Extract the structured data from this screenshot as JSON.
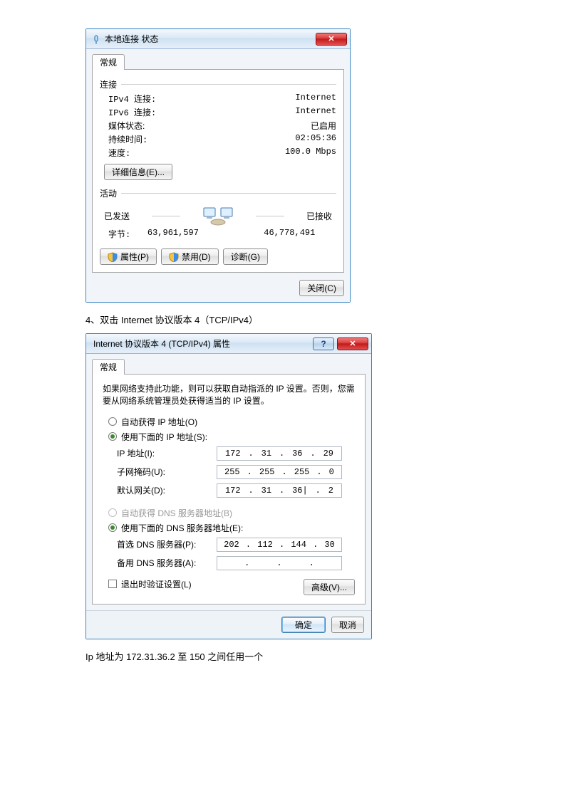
{
  "doc": {
    "step4_text": "4、双击 Internet 协议版本 4（TCP/IPv4）",
    "ip_note": "Ip 地址为 172.31.36.2 至 150 之间任用一个"
  },
  "dlg1": {
    "title": "本地连接 状态",
    "tab": "常规",
    "conn_header": "连接",
    "rows": {
      "ipv4_k": "IPv4 连接:",
      "ipv4_v": "Internet",
      "ipv6_k": "IPv6 连接:",
      "ipv6_v": "Internet",
      "media_k": "媒体状态:",
      "media_v": "已启用",
      "dur_k": "持续时间:",
      "dur_v": "02:05:36",
      "speed_k": "速度:",
      "speed_v": "100.0 Mbps"
    },
    "detail_btn": "详细信息(E)...",
    "activity_header": "活动",
    "sent_label": "已发送",
    "recv_label": "已接收",
    "bytes_label": "字节:",
    "sent_bytes": "63,961,597",
    "recv_bytes": "46,778,491",
    "btn_props": "属性(P)",
    "btn_disable": "禁用(D)",
    "btn_diag": "诊断(G)",
    "btn_close": "关闭(C)"
  },
  "dlg2": {
    "title": "Internet 协议版本 4 (TCP/IPv4) 属性",
    "tab": "常规",
    "paragraph": "如果网络支持此功能，则可以获取自动指派的 IP 设置。否则，您需要从网络系统管理员处获得适当的 IP 设置。",
    "r_auto_ip": "自动获得 IP 地址(O)",
    "r_use_ip": "使用下面的 IP 地址(S):",
    "f_ip": "IP 地址(I):",
    "f_mask": "子网掩码(U):",
    "f_gw": "默认网关(D):",
    "ip": {
      "a": "172",
      "b": "31",
      "c": "36",
      "d": "29"
    },
    "mask": {
      "a": "255",
      "b": "255",
      "c": "255",
      "d": "0"
    },
    "gw": {
      "a": "172",
      "b": "31",
      "c": "36|",
      "d": "2"
    },
    "r_auto_dns": "自动获得 DNS 服务器地址(B)",
    "r_use_dns": "使用下面的 DNS 服务器地址(E):",
    "f_dns1": "首选 DNS 服务器(P):",
    "f_dns2": "备用 DNS 服务器(A):",
    "dns1": {
      "a": "202",
      "b": "112",
      "c": "144",
      "d": "30"
    },
    "chk_validate": "退出时验证设置(L)",
    "btn_adv": "高级(V)...",
    "btn_ok": "确定",
    "btn_cancel": "取消",
    "help_q": "?"
  }
}
